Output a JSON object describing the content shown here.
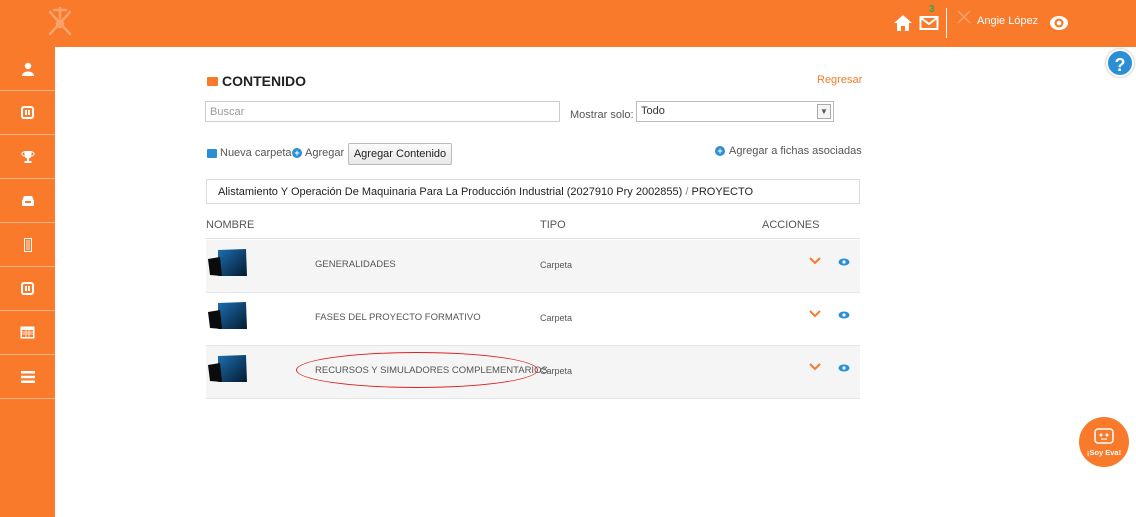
{
  "topbar": {
    "mail_badge": "3",
    "user_name": "Angie López"
  },
  "help": {
    "label": "?"
  },
  "sidebar": {
    "items": [
      {
        "icon": "user-icon"
      },
      {
        "icon": "card-icon"
      },
      {
        "icon": "trophy-icon"
      },
      {
        "icon": "inbox-icon"
      },
      {
        "icon": "text-doc-icon"
      },
      {
        "icon": "card-icon"
      },
      {
        "icon": "calendar-icon"
      },
      {
        "icon": "menu-icon"
      }
    ]
  },
  "content": {
    "title": "CONTENIDO",
    "back_label": "Regresar",
    "search_placeholder": "Buscar",
    "filter_label": "Mostrar solo:",
    "filter_value": "Todo",
    "new_folder_label": "Nueva carpeta",
    "add_label": "Agregar",
    "add_content_label": "Agregar Contenido",
    "add_assoc_label": "Agregar a fichas asociadas",
    "breadcrumb_main": "Alistamiento Y Operación De Maquinaria Para La Producción Industrial (2027910 Pry 2002855)",
    "breadcrumb_sep": " / ",
    "breadcrumb_end": "PROYECTO"
  },
  "table": {
    "headers": {
      "name": "NOMBRE",
      "type": "TIPO",
      "actions": "ACCIONES"
    },
    "rows": [
      {
        "name": "GENERALIDADES",
        "type": "Carpeta"
      },
      {
        "name": "FASES DEL PROYECTO FORMATIVO",
        "type": "Carpeta"
      },
      {
        "name": "RECURSOS Y SIMULADORES COMPLEMENTARIOS",
        "type": "Carpeta"
      }
    ]
  },
  "eva": {
    "label": "¡Soy Eva!"
  },
  "colors": {
    "brand": "#f97a2a",
    "accent": "#2b8fd6",
    "highlight": "#dd2222"
  }
}
